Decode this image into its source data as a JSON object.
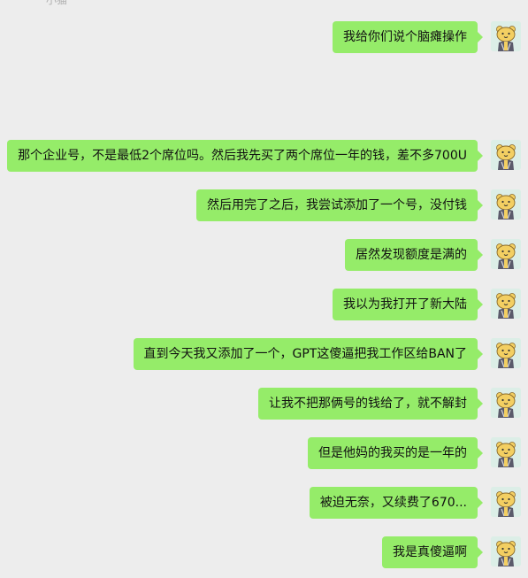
{
  "chat": {
    "top_partial_text": "小猫",
    "messages": [
      {
        "text": "我给你们说个脑瘫操作"
      },
      {
        "text": "那个企业号，不是最低2个席位吗。然后我先买了两个席位一年的钱，差不多700U"
      },
      {
        "text": "然后用完了之后，我尝试添加了一个号，没付钱"
      },
      {
        "text": "居然发现额度是满的"
      },
      {
        "text": "我以为我打开了新大陆"
      },
      {
        "text": "直到今天我又添加了一个，GPT这傻逼把我工作区给BAN了"
      },
      {
        "text": "让我不把那俩号的钱给了，就不解封"
      },
      {
        "text": "但是他妈的我买的是一年的"
      },
      {
        "text": "被迫无奈，又续费了670..."
      },
      {
        "text": "我是真傻逼啊"
      }
    ]
  },
  "colors": {
    "background": "#ededed",
    "bubble": "#95ec69",
    "avatar_bg": "#dceee7",
    "avatar_face": "#f3cf62"
  },
  "icons": {
    "avatar": "cartoon-bear-avatar-icon"
  }
}
